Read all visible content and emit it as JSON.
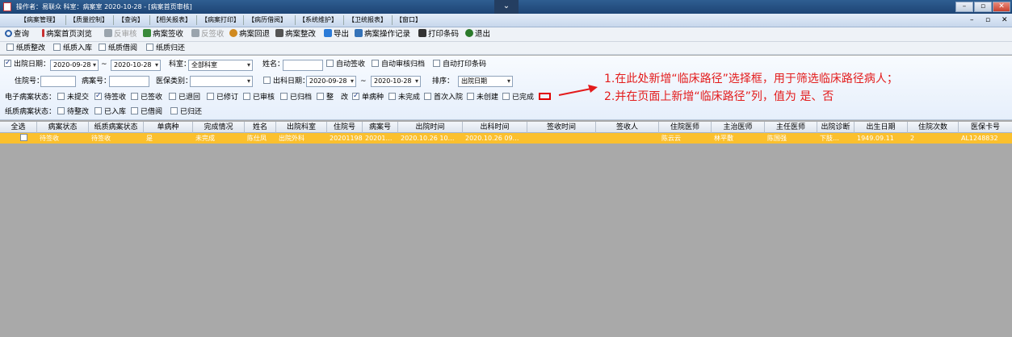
{
  "title": "操作者：易联众  科室：病案室  2020-10-28 - [病案首页审核]",
  "menu": [
    "【病案管理】",
    "【质量控制】",
    "【查询】",
    "【相关报表】",
    "【病案打印】",
    "【病历借阅】",
    "【系统维护】",
    "【卫统报表】",
    "【窗口】"
  ],
  "toolbar": [
    {
      "label": "查询",
      "icon": "search-icon",
      "enabled": true,
      "color": "#2b5fa8"
    },
    {
      "label": "病案首页浏览",
      "icon": "bookmark-icon",
      "enabled": true,
      "color": "#c83030"
    },
    {
      "label": "反审核",
      "icon": "undo-icon",
      "enabled": false,
      "color": "#9aa4ad"
    },
    {
      "label": "病案签收",
      "icon": "sign-icon",
      "enabled": true,
      "color": "#3a8a3a"
    },
    {
      "label": "反签收",
      "icon": "unsign-icon",
      "enabled": false,
      "color": "#9aa4ad"
    },
    {
      "label": "病案回退",
      "icon": "return-icon",
      "enabled": true,
      "color": "#d08a20"
    },
    {
      "label": "病案整改",
      "icon": "edit-icon",
      "enabled": true,
      "color": "#555"
    },
    {
      "label": "导出",
      "icon": "export-icon",
      "enabled": true,
      "color": "#2b7bd8"
    },
    {
      "label": "病案操作记录",
      "icon": "log-icon",
      "enabled": true,
      "color": "#3573b8"
    },
    {
      "label": "打印条码",
      "icon": "print-icon",
      "enabled": true,
      "color": "#333"
    },
    {
      "label": "退出",
      "icon": "exit-icon",
      "enabled": true,
      "color": "#2b7a2b"
    }
  ],
  "paper_options": [
    "纸质整改",
    "纸质入库",
    "纸质借阅",
    "纸质归还"
  ],
  "filters": {
    "discharge_date_label": "出院日期：",
    "discharge_from": "2020-09-28",
    "tilde": "~",
    "discharge_to": "2020-10-28",
    "dept_label": "科室：",
    "dept_value": "全部科室",
    "name_label": "姓名：",
    "auto_sign": "自动签收",
    "auto_review": "自动审核归档",
    "auto_print": "自动打印条码",
    "inpatient_label": "住院号：",
    "record_label": "病案号：",
    "insurance_label": "医保类别：",
    "dept_out_label": "出科日期：",
    "dept_out_from": "2020-09-28",
    "dept_out_to": "2020-10-28",
    "sort_label": "排序：",
    "sort_value": "出院日期",
    "e_status_label": "电子病案状态：",
    "e_status": [
      {
        "label": "未提交",
        "checked": false
      },
      {
        "label": "待签收",
        "checked": true
      },
      {
        "label": "已签收",
        "checked": false
      },
      {
        "label": "已退回",
        "checked": false
      },
      {
        "label": "已修订",
        "checked": false
      },
      {
        "label": "已审核",
        "checked": false
      },
      {
        "label": "已归档",
        "checked": false
      },
      {
        "label": "整　改",
        "checked": false
      },
      {
        "label": "单病种",
        "checked": true
      },
      {
        "label": "未完成",
        "checked": false
      },
      {
        "label": "首次入院",
        "checked": false
      },
      {
        "label": "未创建",
        "checked": false
      },
      {
        "label": "已完成",
        "checked": false
      }
    ],
    "p_status_label": "纸质病案状态：",
    "p_status": [
      {
        "label": "待整改",
        "checked": false
      },
      {
        "label": "已入库",
        "checked": false
      },
      {
        "label": "已借阅",
        "checked": false
      },
      {
        "label": "已归还",
        "checked": false
      }
    ]
  },
  "annotation": {
    "line1": "1.在此处新增“临床路径”选择框，用于筛选临床路径病人；",
    "line2": "2.并在页面上新增“临床路径”列，值为  是、否",
    "color": "#e31b1b"
  },
  "table": {
    "headers": [
      "全选",
      "病案状态",
      "纸质病案状态",
      "单病种",
      "完成情况",
      "姓名",
      "出院科室",
      "住院号",
      "病案号",
      "出院时间",
      "出科时间",
      "签收时间",
      "签收人",
      "住院医师",
      "主治医师",
      "主任医师",
      "出院诊断",
      "出生日期",
      "住院次数",
      "医保卡号"
    ],
    "rows": [
      [
        "",
        "待签收",
        "待签收",
        "是",
        "未完成",
        "陈仕凤",
        "出院外科",
        "20201198",
        "20201…",
        "2020.10.26 10…",
        "2020.10.26 09…",
        "",
        "",
        "陈云云",
        "林平敷",
        "陈国强",
        "下肢…",
        "1949.09.11",
        "2",
        "AL1248832"
      ]
    ],
    "row_color": "#fbc02d"
  }
}
